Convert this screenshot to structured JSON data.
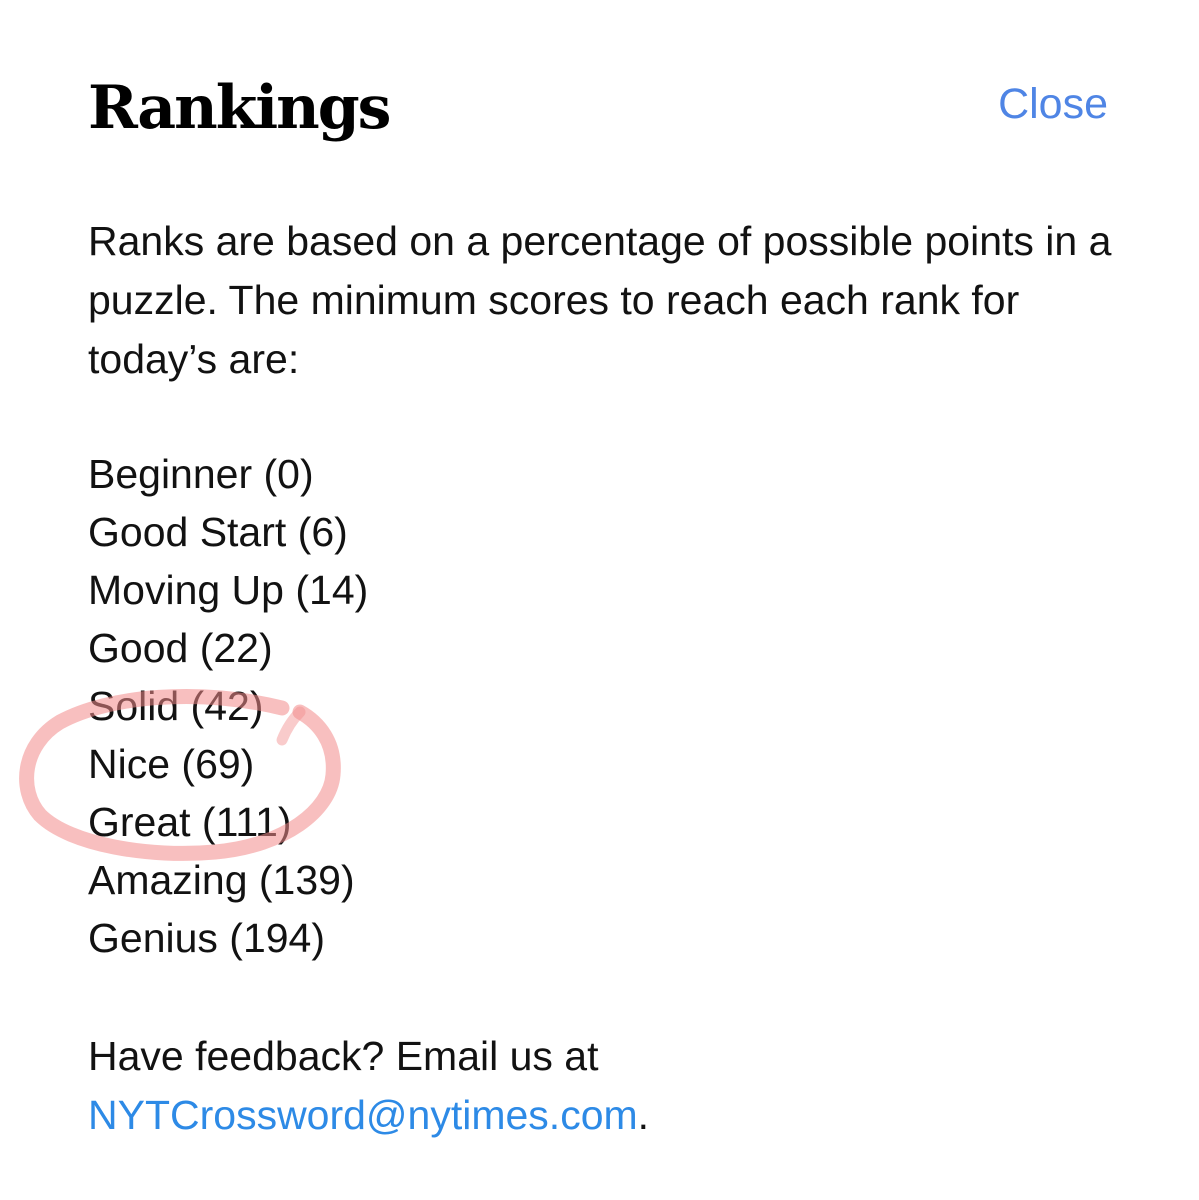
{
  "header": {
    "title": "Rankings",
    "close_label": "Close"
  },
  "intro": {
    "text": "Ranks are based on a percentage of possible points in a puzzle. The minimum scores to reach each rank for today’s are:"
  },
  "ranks": [
    {
      "label": "Beginner (0)",
      "name": "Beginner",
      "min_score": 0
    },
    {
      "label": "Good Start (6)",
      "name": "Good Start",
      "min_score": 6
    },
    {
      "label": "Moving Up (14)",
      "name": "Moving Up",
      "min_score": 14
    },
    {
      "label": "Good (22)",
      "name": "Good",
      "min_score": 22
    },
    {
      "label": "Solid (42)",
      "name": "Solid",
      "min_score": 42
    },
    {
      "label": "Nice (69)",
      "name": "Nice",
      "min_score": 69
    },
    {
      "label": "Great (111)",
      "name": "Great",
      "min_score": 111
    },
    {
      "label": "Amazing (139)",
      "name": "Amazing",
      "min_score": 139
    },
    {
      "label": "Genius (194)",
      "name": "Genius",
      "min_score": 194
    }
  ],
  "feedback": {
    "prefix": "Have feedback? Email us at",
    "email": "NYTCrossword@nytimes.com",
    "suffix": "."
  },
  "colors": {
    "link": "#2d8ae6",
    "close": "#4f85e5",
    "text": "#121212",
    "annotation_circle": "#f28b8b"
  },
  "annotation": {
    "kind": "hand-drawn circle",
    "highlighted_rank": "Nice (69)"
  }
}
